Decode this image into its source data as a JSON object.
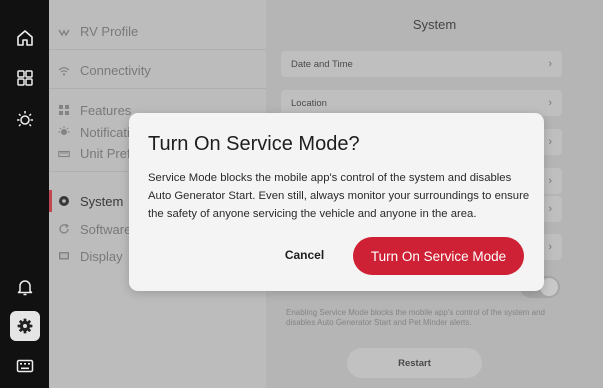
{
  "rail": {
    "items": [
      {
        "icon": "home-icon"
      },
      {
        "icon": "grid-icon"
      },
      {
        "icon": "sun-icon"
      },
      {
        "icon": "bell-icon"
      },
      {
        "icon": "gear-icon",
        "active": true
      },
      {
        "icon": "keyboard-icon"
      }
    ]
  },
  "settings_nav": {
    "items": [
      {
        "label": "RV Profile",
        "icon": "rv-icon"
      },
      {
        "label": "Connectivity",
        "icon": "wifi-icon"
      },
      {
        "label": "Features",
        "icon": "features-icon"
      },
      {
        "label": "Notifications",
        "icon": "notification-icon"
      },
      {
        "label": "Unit Preferences",
        "icon": "ruler-icon"
      },
      {
        "label": "System",
        "icon": "system-icon",
        "active": true
      },
      {
        "label": "Software Updates",
        "icon": "refresh-icon"
      },
      {
        "label": "Display",
        "icon": "display-icon"
      }
    ]
  },
  "system": {
    "title": "System",
    "rows": [
      {
        "label": "Date and Time"
      },
      {
        "label": "Location"
      },
      {
        "label": ""
      },
      {
        "label": ""
      },
      {
        "label": ""
      },
      {
        "label": ""
      }
    ],
    "service_mode_note": "Enabling Service Mode blocks the mobile app's control of the system and disables Auto Generator Start and Pet Minder alerts.",
    "restart_label": "Restart"
  },
  "modal": {
    "title": "Turn On Service Mode?",
    "body": "Service Mode blocks the mobile app's control of the system and disables Auto Generator Start. Even still, always monitor your surroundings to ensure the safety of anyone servicing the vehicle and anyone in the area.",
    "cancel_label": "Cancel",
    "confirm_label": "Turn On Service Mode"
  },
  "colors": {
    "accent": "#cf2135",
    "rail_bg": "#111111"
  }
}
